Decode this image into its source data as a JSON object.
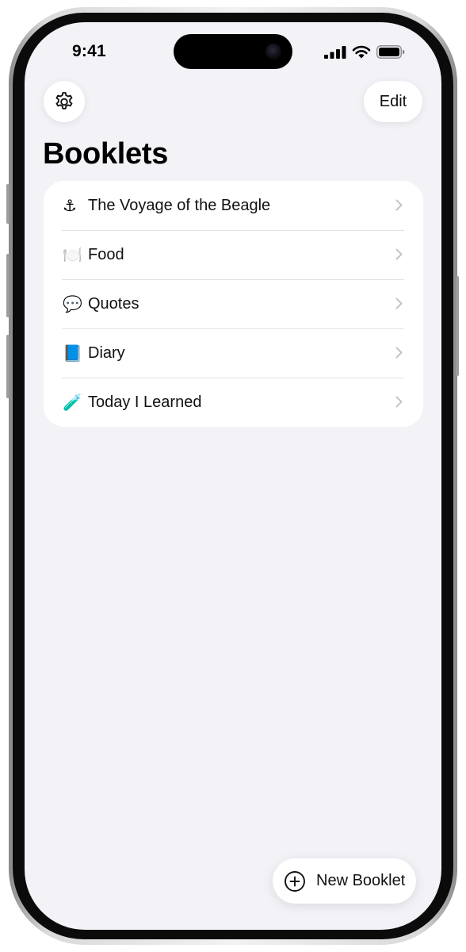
{
  "status_bar": {
    "time": "9:41",
    "icons": [
      "cellular-signal-icon",
      "wifi-icon",
      "battery-icon"
    ]
  },
  "toolbar": {
    "settings_icon": "gear-icon",
    "edit_label": "Edit"
  },
  "page": {
    "title": "Booklets"
  },
  "booklets": [
    {
      "emoji": "⚓",
      "label": "The Voyage of the Beagle"
    },
    {
      "emoji": "🍽️",
      "label": "Food"
    },
    {
      "emoji": "💬",
      "label": "Quotes"
    },
    {
      "emoji": "📘",
      "label": "Diary"
    },
    {
      "emoji": "🧪",
      "label": "Today I Learned"
    }
  ],
  "new_booklet": {
    "icon": "plus-circle-icon",
    "label": "New Booklet"
  },
  "colors": {
    "background": "#f2f2f7",
    "card": "#ffffff",
    "chevron": "#c4c4c7",
    "separator": "#e2e2e6"
  }
}
